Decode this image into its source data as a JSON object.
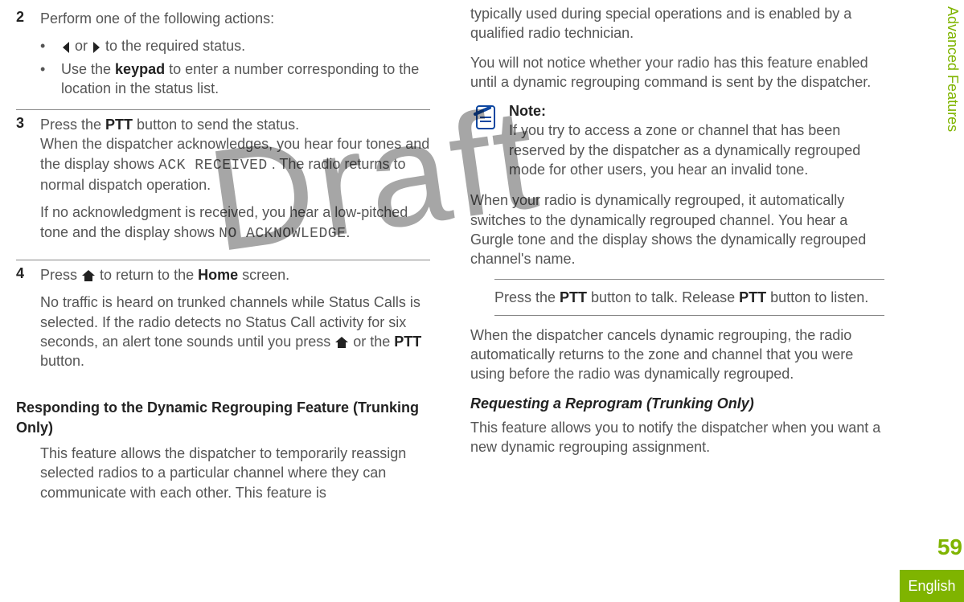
{
  "watermark": "Draft",
  "sidebar": {
    "section": "Advanced Features",
    "page_number": "59",
    "language": "English"
  },
  "left": {
    "step2": {
      "num": "2",
      "intro": "Perform one of the following actions:",
      "bullet1_pre": "",
      "bullet1_mid": " or ",
      "bullet1_post": " to the required status.",
      "bullet2_a": "Use the ",
      "bullet2_b": "keypad",
      "bullet2_c": " to enter a number corresponding to the location in the status list."
    },
    "step3": {
      "num": "3",
      "p1_a": "Press the ",
      "p1_b": "PTT",
      "p1_c": " button to send the status.",
      "p2_a": "When the dispatcher acknowledges, you hear four tones and the display shows ",
      "p2_code": "ACK RECEIVED",
      "p2_b": " . The radio returns to normal dispatch operation.",
      "p3_a": "If no acknowledgment is received, you hear a low-pitched tone and the display shows ",
      "p3_code": "NO ACKNOWLEDGE",
      "p3_b": "."
    },
    "step4": {
      "num": "4",
      "p1_a": "Press ",
      "p1_b": " to return to the ",
      "p1_c": "Home",
      "p1_d": " screen.",
      "p2_a": "No traffic is heard on trunked channels while Status Calls is selected. If the radio detects no Status Call activity for six seconds, an alert tone sounds until you press ",
      "p2_b": " or the ",
      "p2_c": "PTT",
      "p2_d": " button."
    },
    "heading": "Responding to the Dynamic Regrouping Feature (Trunking Only)",
    "para": "This feature allows the dispatcher to temporarily reassign selected radios to a particular channel where they can communicate with each other. This feature is"
  },
  "right": {
    "p1": "typically used during special operations and is enabled by a qualified radio technician.",
    "p2": "You will not notice whether your radio has this feature enabled until a dynamic regrouping command is sent by the dispatcher.",
    "note_label": "Note:",
    "note_body": "If you try to access a zone or channel that has been reserved by the dispatcher as a dynamically regrouped mode for other users, you hear an invalid tone.",
    "p3": "When your radio is dynamically regrouped, it automatically switches to the dynamically regrouped channel. You hear a Gurgle tone and the display shows the dynamically regrouped channel's name.",
    "ptt_a": "Press the ",
    "ptt_b": "PTT",
    "ptt_c": " button to talk. Release ",
    "ptt_d": "PTT",
    "ptt_e": " button to listen.",
    "p4": "When the dispatcher cancels dynamic regrouping, the radio automatically returns to the zone and channel that you were using before the radio was dynamically regrouped.",
    "sub": "Requesting a Reprogram (Trunking Only)",
    "p5": "This feature allows you to notify the dispatcher when you want a new dynamic regrouping assignment."
  }
}
